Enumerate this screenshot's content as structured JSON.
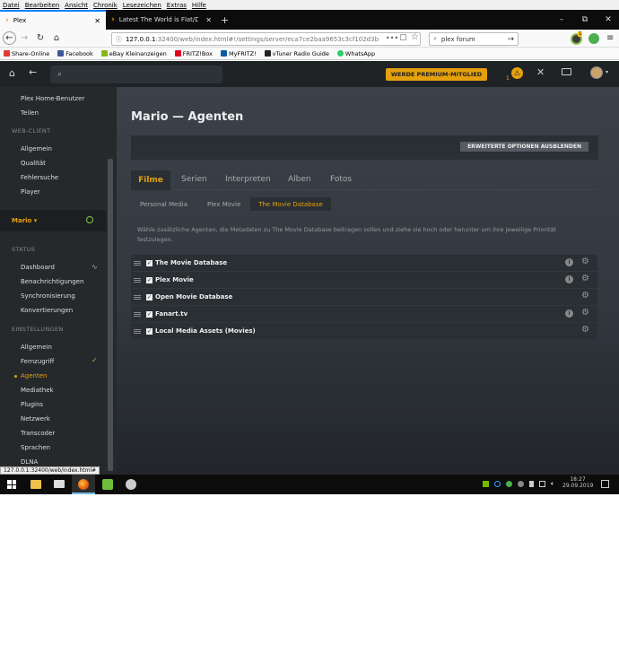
{
  "menubar": [
    "Datei",
    "Bearbeiten",
    "Ansicht",
    "Chronik",
    "Lesezeichen",
    "Extras",
    "Hilfe"
  ],
  "tabs": [
    {
      "label": "Plex",
      "active": true
    },
    {
      "label": "Latest The World is Flat/Deutsc",
      "active": false
    }
  ],
  "window_controls": [
    "–",
    "⧉",
    "✕"
  ],
  "url": {
    "host": "127.0.0.1",
    "rest": ":32400/web/index.html#!/settings/server/eca7ce2baa9653c3cf102d3b"
  },
  "search": {
    "value": "plex forum"
  },
  "toolbar_badge": "1",
  "bookmarks": [
    {
      "label": "Share-Online",
      "color": "#e53935"
    },
    {
      "label": "Facebook",
      "color": "#3b5998"
    },
    {
      "label": "eBay Kleinanzeigen",
      "color": "#86b817"
    },
    {
      "label": "FRITZ!Box",
      "color": "#e2001a"
    },
    {
      "label": "MyFRITZ!",
      "color": "#0a5aa5"
    },
    {
      "label": "vTuner Radio Guide",
      "color": "#222222"
    },
    {
      "label": "WhatsApp",
      "color": "#25d366"
    }
  ],
  "plex": {
    "premium_label": "WERDE PREMIUM-MITGLIED",
    "activity_count": "1"
  },
  "sidebar": {
    "top_items": [
      "Plex Home-Benutzer",
      "Teilen"
    ],
    "webclient_head": "WEB-CLIENT",
    "webclient_items": [
      "Allgemein",
      "Qualität",
      "Fehlersuche",
      "Player"
    ],
    "server_name": "Mario ▾",
    "status_head": "STATUS",
    "status_items": [
      "Dashboard",
      "Benachrichtigungen",
      "Synchronisierung",
      "Konvertierungen"
    ],
    "settings_head": "EINSTELLUNGEN",
    "settings_items": [
      "Allgemein",
      "Fernzugriff",
      "Agenten",
      "Mediathek",
      "Plugins",
      "Netzwerk",
      "Transcoder",
      "Sprachen",
      "DLNA"
    ],
    "status_url": "127.0.0.1:32400/web/index.html#"
  },
  "main": {
    "title": "Mario — Agenten",
    "advanced_button": "ERWEITERTE OPTIONEN AUSBLENDEN",
    "type_tabs": [
      "Filme",
      "Serien",
      "Interpreten",
      "Alben",
      "Fotos"
    ],
    "agent_tabs": [
      "Personal Media",
      "Plex Movie",
      "The Movie Database"
    ],
    "description": "Wähle zusätzliche Agenten, die Metadaten zu The Movie Database beitragen sollen und ziehe sie hoch oder herunter um ihre jeweilige Priorität festzulegen.",
    "agents": [
      {
        "label": "The Movie Database",
        "info": true
      },
      {
        "label": "Plex Movie",
        "info": true
      },
      {
        "label": "Open Movie Database",
        "info": false
      },
      {
        "label": "Fanart.tv",
        "info": true
      },
      {
        "label": "Local Media Assets (Movies)",
        "info": false
      }
    ]
  },
  "taskbar": {
    "clock_time": "18:27",
    "clock_date": "29.09.2019"
  },
  "colors": {
    "accent": "#e5a00d",
    "sidebar": "#25292c",
    "header": "#1f2326"
  }
}
